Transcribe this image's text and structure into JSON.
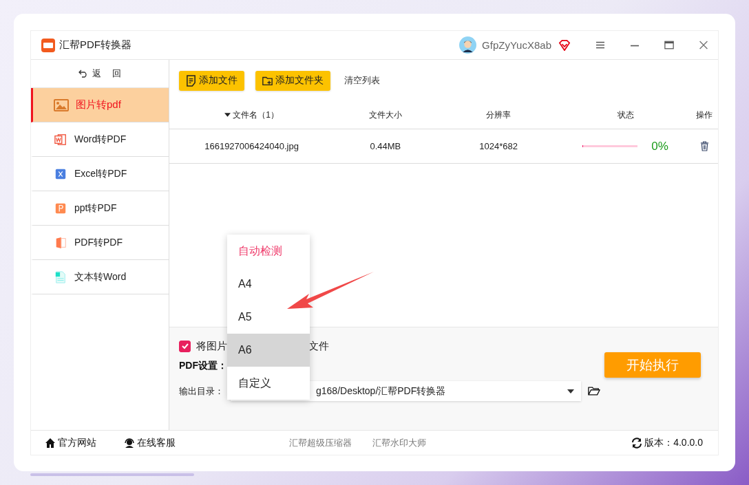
{
  "app": {
    "title": "汇帮PDF转换器",
    "user": "GfpZyYucX8ab"
  },
  "sidebar": {
    "back": "返 回",
    "items": [
      {
        "label": "图片转pdf",
        "kind": "image",
        "selected": true
      },
      {
        "label": "Word转PDF",
        "kind": "word",
        "selected": false
      },
      {
        "label": "Excel转PDF",
        "kind": "excel",
        "selected": false
      },
      {
        "label": "ppt转PDF",
        "kind": "ppt",
        "selected": false
      },
      {
        "label": "PDF转PDF",
        "kind": "pdf",
        "selected": false
      },
      {
        "label": "文本转Word",
        "kind": "text",
        "selected": false
      }
    ]
  },
  "toolbar": {
    "buttons": [
      {
        "label": "添加文件",
        "kind": "file"
      },
      {
        "label": "添加文件夹",
        "kind": "folder"
      }
    ],
    "clear": "清空列表"
  },
  "table": {
    "columns": [
      {
        "label": "文件名（1）",
        "sorted": true
      },
      {
        "label": "文件大小",
        "sorted": false
      },
      {
        "label": "分辨率",
        "sorted": false
      },
      {
        "label": "状态",
        "sorted": false
      },
      {
        "label": "操作",
        "sorted": false
      }
    ],
    "rows": [
      {
        "name": "1661927006424040.jpg",
        "size": "0.44MB",
        "resolution": "1024*682",
        "level": 0,
        "percent": "0%"
      }
    ]
  },
  "settings": {
    "checkbox": {
      "checked": true,
      "label_parts": [
        "将图片",
        "文件"
      ]
    },
    "pdf_label": "PDF设置：",
    "output_label": "输出目录：",
    "output_path": "g168/Desktop/汇帮PDF转换器"
  },
  "start_button": "开始执行",
  "dropdown": {
    "options": [
      {
        "label": "自动检测",
        "selected": true,
        "hovered": false
      },
      {
        "label": "A4",
        "selected": false,
        "hovered": false
      },
      {
        "label": "A5",
        "selected": false,
        "hovered": false
      },
      {
        "label": "A6",
        "selected": false,
        "hovered": true
      },
      {
        "label": "自定义",
        "selected": false,
        "hovered": false
      }
    ]
  },
  "footer": {
    "left": [
      {
        "label": "官方网站",
        "kind": "home"
      },
      {
        "label": "在线客服",
        "kind": "headset"
      }
    ],
    "links": [
      "汇帮超级压缩器",
      "汇帮水印大师"
    ],
    "version": "版本：4.0.0.0"
  }
}
